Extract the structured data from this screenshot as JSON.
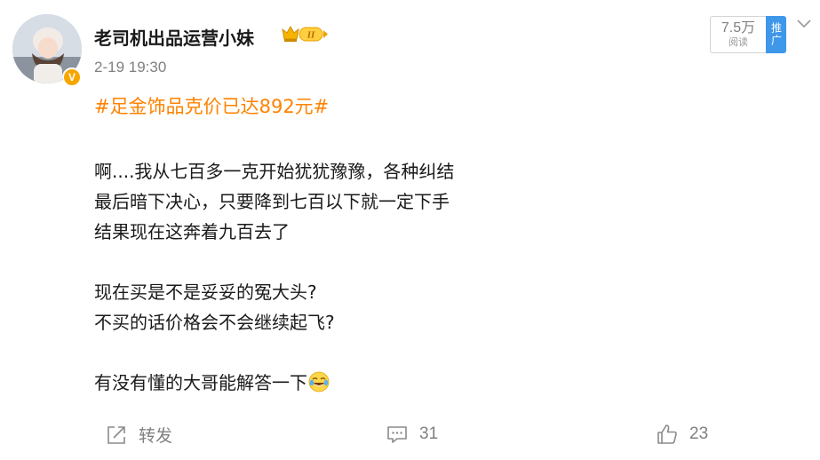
{
  "user": {
    "name": "老司机出品运营小妹",
    "verified_badge": "V",
    "rank_badge": "II"
  },
  "post": {
    "time": "2-19 19:30",
    "topic": "#足金饰品克价已达892元#",
    "lines": [
      "啊....我从七百多一克开始犹犹豫豫，各种纠结",
      "最后暗下决心，只要降到七百以下就一定下手",
      "结果现在这奔着九百去了",
      "",
      "现在买是不是妥妥的冤大头?",
      "不买的话价格会不会继续起飞?",
      "",
      "有没有懂的大哥能解答一下"
    ],
    "emoji": "crying-laughing-emoji"
  },
  "stats": {
    "reads": "7.5万",
    "reads_label": "阅读",
    "promote_label": "推广"
  },
  "actions": {
    "repost_label": "转发",
    "comment_count": "31",
    "like_count": "23"
  },
  "colors": {
    "topic": "#ff8200",
    "promote_bg": "#3f97ea",
    "verified_bg": "#f7a600",
    "muted": "#808080"
  }
}
